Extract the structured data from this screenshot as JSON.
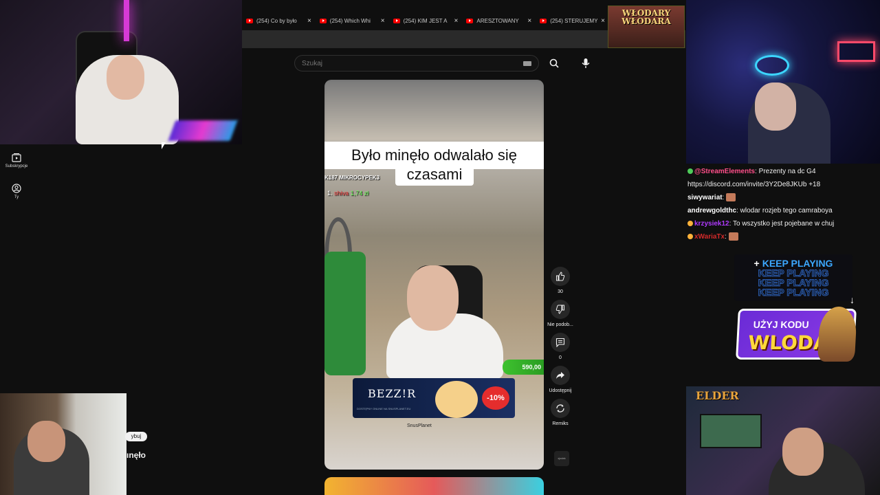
{
  "browser": {
    "tabs": [
      {
        "title": "(254) Co by było"
      },
      {
        "title": "(254) Which Whi"
      },
      {
        "title": "(254) KIM JEST A"
      },
      {
        "title": "ARESZTOWANY"
      },
      {
        "title": "(254) STERUJEMY"
      }
    ],
    "close_glyph": "×"
  },
  "banner": {
    "title": "WŁODARY WŁODARA"
  },
  "youtube": {
    "search_placeholder": "Szukaj",
    "sidenav": [
      {
        "icon": "subscriptions-icon",
        "label": "Subskrypcje"
      },
      {
        "icon": "account-icon",
        "label": "Ty"
      }
    ]
  },
  "short": {
    "caption_line1": "Było minęło odwalało się",
    "caption_line2": "czasami",
    "channel": "K187  MIKROCYPEK3",
    "donor_rank": "1.",
    "donor_name": "shiva",
    "donor_amount": "1,74 zł",
    "price_tag": "590,00",
    "ad_brand": "BEZZ!R",
    "ad_promo": "-10%",
    "ad_small": "DOSTĘPNY ONLINE NA SNUSPLANET.EU",
    "ad_footer": "SnusPlanet"
  },
  "actions": {
    "like_count": "30",
    "dislike_label": "Nie podob...",
    "comments_count": "0",
    "share_label": "Udostępnij",
    "remix_label": "Remiks",
    "thumb_label": "xjxdek"
  },
  "chat": [
    {
      "name": "@StreamElements",
      "name_color": "#ff4f8a",
      "text": ": Prezenty na dc G4",
      "badge": "#4ecb5a"
    },
    {
      "name": "",
      "name_color": "#ffffff",
      "text": "https://discord.com/invite/3Y2De8JKUb +18",
      "badge": ""
    },
    {
      "name": "siwywariat",
      "name_color": "#ffffff",
      "text": ":",
      "badge": "",
      "emote": true
    },
    {
      "name": "andrewgoldthc",
      "name_color": "#ffffff",
      "text": ": wlodar rozjeb tego camraboya",
      "badge": ""
    },
    {
      "name": "krzysiek12",
      "name_color": "#b03aff",
      "text": ": To wszystko jest pojebane w chuj",
      "badge": "#ffb23a"
    },
    {
      "name": "xWariaTx",
      "name_color": "#d42a2a",
      "text": ":",
      "badge": "#ffb23a",
      "emote": true
    }
  ],
  "keepplaying": {
    "label": "KEEP PLAYING",
    "plus": "+"
  },
  "promo": {
    "line1": "UŻYJ KODU",
    "line2": "WLODAR"
  },
  "cams": {
    "br_logo": "ELDER"
  },
  "overlay": {
    "pill": "ybuj",
    "text": "ınęło"
  },
  "colors": {
    "accent_green": "#3ec22f",
    "youtube_red": "#ff0000",
    "chat_bg": "#0f0f0f"
  }
}
